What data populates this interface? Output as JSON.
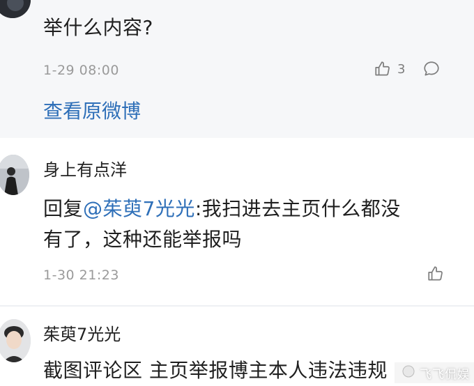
{
  "top_comment": {
    "text": "举什么内容?",
    "time": "1-29 08:00",
    "likes": "3",
    "view_original": "查看原微博"
  },
  "reply_1": {
    "username": "身上有点洋",
    "reply_prefix": "回复",
    "mention": "@茱萸7光光",
    "text_line1": ":我扫进去主页什么都没",
    "text_line2": "有了，这种还能举报吗",
    "time": "1-30 21:23"
  },
  "reply_2": {
    "username": "茱萸7光光",
    "text": "截图评论区 主页举报博主本人违法违规"
  },
  "watermark": {
    "text": "飞飞侃娱"
  },
  "colors": {
    "link": "#2e6fb8",
    "meta": "#9a9a9a",
    "top_bg": "#f6f7f9"
  }
}
